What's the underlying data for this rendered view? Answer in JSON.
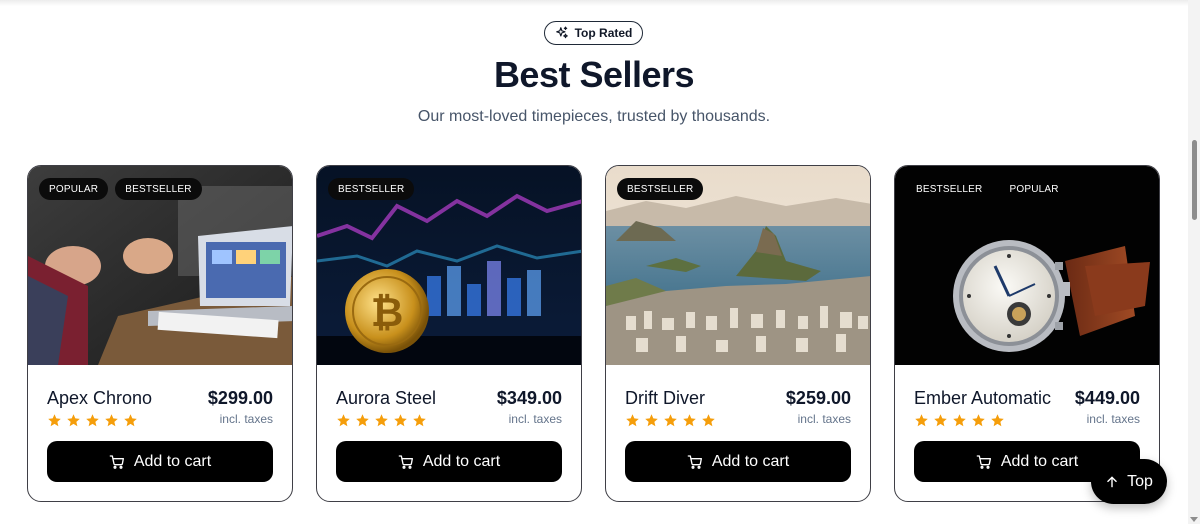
{
  "section": {
    "badge_label": "Top Rated",
    "title": "Best Sellers",
    "subtitle": "Our most-loved timepieces, trusted by thousands."
  },
  "products": [
    {
      "name": "Apex Chrono",
      "price": "$299.00",
      "taxes": "incl. taxes",
      "tags": [
        "POPULAR",
        "BESTSELLER"
      ],
      "rating": 5,
      "cta": "Add to cart",
      "image": "laptop-meeting-photo"
    },
    {
      "name": "Aurora Steel",
      "price": "$349.00",
      "taxes": "incl. taxes",
      "tags": [
        "BESTSELLER"
      ],
      "rating": 5,
      "cta": "Add to cart",
      "image": "bitcoin-coin-photo"
    },
    {
      "name": "Drift Diver",
      "price": "$259.00",
      "taxes": "incl. taxes",
      "tags": [
        "BESTSELLER"
      ],
      "rating": 5,
      "cta": "Add to cart",
      "image": "coastal-city-photo"
    },
    {
      "name": "Ember Automatic",
      "price": "$449.00",
      "taxes": "incl. taxes",
      "tags": [
        "BESTSELLER",
        "POPULAR"
      ],
      "rating": 5,
      "cta": "Add to cart",
      "image": "wristwatch-photo"
    }
  ],
  "back_to_top": {
    "label": "Top",
    "icon": "arrow-up-icon"
  },
  "colors": {
    "star": "#f59e0b",
    "button": "#000000",
    "title": "#0f172a"
  }
}
